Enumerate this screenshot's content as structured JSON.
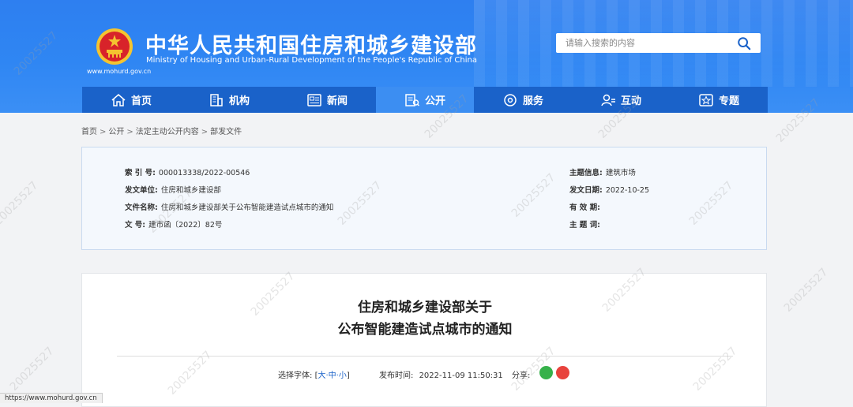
{
  "header": {
    "title": "中华人民共和国住房和城乡建设部",
    "subtitle": "Ministry of Housing and Urban-Rural Development of the People's Republic of China",
    "url": "www.mohurd.gov.cn",
    "search_placeholder": "请输入搜索的内容",
    "colors": {
      "header_bg": "#2f86f3",
      "nav_bg": "#1a62c9",
      "nav_active": "#3c8ef2"
    }
  },
  "nav": {
    "items": [
      {
        "label": "首页",
        "icon": "home-icon"
      },
      {
        "label": "机构",
        "icon": "building-icon"
      },
      {
        "label": "新闻",
        "icon": "news-icon"
      },
      {
        "label": "公开",
        "icon": "public-icon",
        "active": true
      },
      {
        "label": "服务",
        "icon": "service-icon"
      },
      {
        "label": "互动",
        "icon": "interact-icon"
      },
      {
        "label": "专题",
        "icon": "topic-icon"
      }
    ]
  },
  "breadcrumb": [
    "首页",
    "公开",
    "法定主动公开内容",
    "部发文件"
  ],
  "info": {
    "index_label": "索  引  号:",
    "index_value": "000013338/2022-00546",
    "unit_label": "发文单位:",
    "unit_value": "住房和城乡建设部",
    "filename_label": "文件名称:",
    "filename_value": "住房和城乡建设部关于公布智能建造试点城市的通知",
    "docno_label": "文      号:",
    "docno_value": "建市函〔2022〕82号",
    "topic_label": "主题信息:",
    "topic_value": "建筑市场",
    "date_label": "发文日期:",
    "date_value": "2022-10-25",
    "validity_label": "有  效  期:",
    "validity_value": "",
    "keywords_label": "主  题  词:",
    "keywords_value": ""
  },
  "article": {
    "title_line1": "住房和城乡建设部关于",
    "title_line2": "公布智能建造试点城市的通知",
    "font_label": "选择字体:",
    "font_open": "[",
    "font_large": "大",
    "font_mid": "中",
    "font_small": "小",
    "font_close": "]",
    "font_dash": "·",
    "publish_label": "发布时间:",
    "publish_time": "2022-11-09 11:50:31",
    "share_label": "分享:"
  },
  "watermark": "20025527",
  "status_url": "https://www.mohurd.gov.cn"
}
